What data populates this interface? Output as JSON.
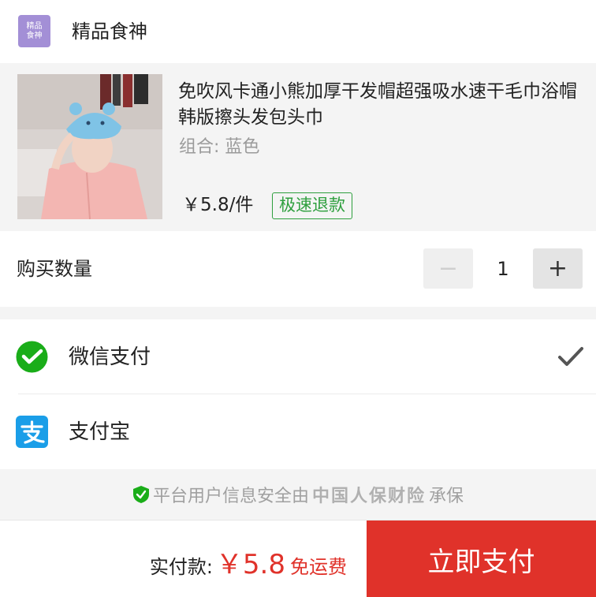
{
  "shop": {
    "logo_text_line1": "精品",
    "logo_text_line2": "食神",
    "name": "精品食神"
  },
  "product": {
    "title": "免吹风卡通小熊加厚干发帽超强吸水速干毛巾浴帽韩版擦头发包头巾",
    "variant": "组合: 蓝色",
    "price": "￥5.8/件",
    "badge": "极速退款"
  },
  "quantity": {
    "label": "购买数量",
    "minus": "−",
    "value": "1",
    "plus": "+"
  },
  "payment": {
    "options": [
      {
        "label": "微信支付",
        "icon": "wechat-pay-icon",
        "selected": true
      },
      {
        "label": "支付宝",
        "icon": "alipay-icon",
        "selected": false
      }
    ]
  },
  "insurance": {
    "prefix": "平台用户信息安全由",
    "brand": "中国人保财险",
    "suffix": "承保"
  },
  "footer": {
    "total_label": "实付款:",
    "total_price": "￥5.8",
    "free_shipping": "免运费",
    "pay_button": "立即支付"
  },
  "colors": {
    "accent_red": "#e0322a",
    "wechat_green": "#1aad19",
    "alipay_blue": "#1a9ee8",
    "badge_green": "#2e9f3e",
    "logo_purple": "#a38fd6"
  }
}
